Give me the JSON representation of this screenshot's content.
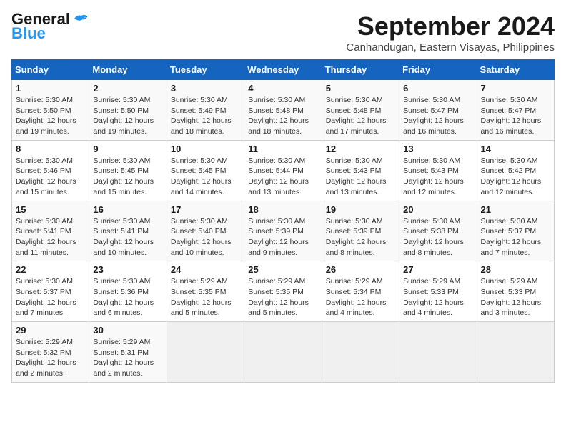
{
  "header": {
    "logo_line1": "General",
    "logo_line2": "Blue",
    "title": "September 2024",
    "subtitle": "Canhandugan, Eastern Visayas, Philippines"
  },
  "weekdays": [
    "Sunday",
    "Monday",
    "Tuesday",
    "Wednesday",
    "Thursday",
    "Friday",
    "Saturday"
  ],
  "weeks": [
    [
      {
        "day": "1",
        "info": "Sunrise: 5:30 AM\nSunset: 5:50 PM\nDaylight: 12 hours\nand 19 minutes."
      },
      {
        "day": "2",
        "info": "Sunrise: 5:30 AM\nSunset: 5:50 PM\nDaylight: 12 hours\nand 19 minutes."
      },
      {
        "day": "3",
        "info": "Sunrise: 5:30 AM\nSunset: 5:49 PM\nDaylight: 12 hours\nand 18 minutes."
      },
      {
        "day": "4",
        "info": "Sunrise: 5:30 AM\nSunset: 5:48 PM\nDaylight: 12 hours\nand 18 minutes."
      },
      {
        "day": "5",
        "info": "Sunrise: 5:30 AM\nSunset: 5:48 PM\nDaylight: 12 hours\nand 17 minutes."
      },
      {
        "day": "6",
        "info": "Sunrise: 5:30 AM\nSunset: 5:47 PM\nDaylight: 12 hours\nand 16 minutes."
      },
      {
        "day": "7",
        "info": "Sunrise: 5:30 AM\nSunset: 5:47 PM\nDaylight: 12 hours\nand 16 minutes."
      }
    ],
    [
      {
        "day": "8",
        "info": "Sunrise: 5:30 AM\nSunset: 5:46 PM\nDaylight: 12 hours\nand 15 minutes."
      },
      {
        "day": "9",
        "info": "Sunrise: 5:30 AM\nSunset: 5:45 PM\nDaylight: 12 hours\nand 15 minutes."
      },
      {
        "day": "10",
        "info": "Sunrise: 5:30 AM\nSunset: 5:45 PM\nDaylight: 12 hours\nand 14 minutes."
      },
      {
        "day": "11",
        "info": "Sunrise: 5:30 AM\nSunset: 5:44 PM\nDaylight: 12 hours\nand 13 minutes."
      },
      {
        "day": "12",
        "info": "Sunrise: 5:30 AM\nSunset: 5:43 PM\nDaylight: 12 hours\nand 13 minutes."
      },
      {
        "day": "13",
        "info": "Sunrise: 5:30 AM\nSunset: 5:43 PM\nDaylight: 12 hours\nand 12 minutes."
      },
      {
        "day": "14",
        "info": "Sunrise: 5:30 AM\nSunset: 5:42 PM\nDaylight: 12 hours\nand 12 minutes."
      }
    ],
    [
      {
        "day": "15",
        "info": "Sunrise: 5:30 AM\nSunset: 5:41 PM\nDaylight: 12 hours\nand 11 minutes."
      },
      {
        "day": "16",
        "info": "Sunrise: 5:30 AM\nSunset: 5:41 PM\nDaylight: 12 hours\nand 10 minutes."
      },
      {
        "day": "17",
        "info": "Sunrise: 5:30 AM\nSunset: 5:40 PM\nDaylight: 12 hours\nand 10 minutes."
      },
      {
        "day": "18",
        "info": "Sunrise: 5:30 AM\nSunset: 5:39 PM\nDaylight: 12 hours\nand 9 minutes."
      },
      {
        "day": "19",
        "info": "Sunrise: 5:30 AM\nSunset: 5:39 PM\nDaylight: 12 hours\nand 8 minutes."
      },
      {
        "day": "20",
        "info": "Sunrise: 5:30 AM\nSunset: 5:38 PM\nDaylight: 12 hours\nand 8 minutes."
      },
      {
        "day": "21",
        "info": "Sunrise: 5:30 AM\nSunset: 5:37 PM\nDaylight: 12 hours\nand 7 minutes."
      }
    ],
    [
      {
        "day": "22",
        "info": "Sunrise: 5:30 AM\nSunset: 5:37 PM\nDaylight: 12 hours\nand 7 minutes."
      },
      {
        "day": "23",
        "info": "Sunrise: 5:30 AM\nSunset: 5:36 PM\nDaylight: 12 hours\nand 6 minutes."
      },
      {
        "day": "24",
        "info": "Sunrise: 5:29 AM\nSunset: 5:35 PM\nDaylight: 12 hours\nand 5 minutes."
      },
      {
        "day": "25",
        "info": "Sunrise: 5:29 AM\nSunset: 5:35 PM\nDaylight: 12 hours\nand 5 minutes."
      },
      {
        "day": "26",
        "info": "Sunrise: 5:29 AM\nSunset: 5:34 PM\nDaylight: 12 hours\nand 4 minutes."
      },
      {
        "day": "27",
        "info": "Sunrise: 5:29 AM\nSunset: 5:33 PM\nDaylight: 12 hours\nand 4 minutes."
      },
      {
        "day": "28",
        "info": "Sunrise: 5:29 AM\nSunset: 5:33 PM\nDaylight: 12 hours\nand 3 minutes."
      }
    ],
    [
      {
        "day": "29",
        "info": "Sunrise: 5:29 AM\nSunset: 5:32 PM\nDaylight: 12 hours\nand 2 minutes."
      },
      {
        "day": "30",
        "info": "Sunrise: 5:29 AM\nSunset: 5:31 PM\nDaylight: 12 hours\nand 2 minutes."
      },
      {
        "day": "",
        "info": ""
      },
      {
        "day": "",
        "info": ""
      },
      {
        "day": "",
        "info": ""
      },
      {
        "day": "",
        "info": ""
      },
      {
        "day": "",
        "info": ""
      }
    ]
  ]
}
